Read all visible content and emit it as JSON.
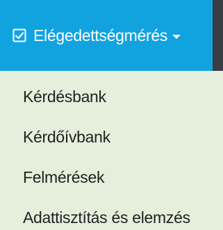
{
  "nav": {
    "tab": {
      "icon": "checkbox-checked-icon",
      "label": "Elégedettségmérés",
      "caret_icon": "caret-down-icon"
    }
  },
  "dropdown": {
    "items": [
      {
        "label": "Kérdésbank"
      },
      {
        "label": "Kérdőívbank"
      },
      {
        "label": "Felmérések"
      },
      {
        "label": "Adattisztítás és elemzés"
      }
    ]
  },
  "colors": {
    "tab_background": "#11a3e0",
    "nav_background": "#3a3e44",
    "dropdown_background": "#e5efdc",
    "item_text": "#222222"
  }
}
